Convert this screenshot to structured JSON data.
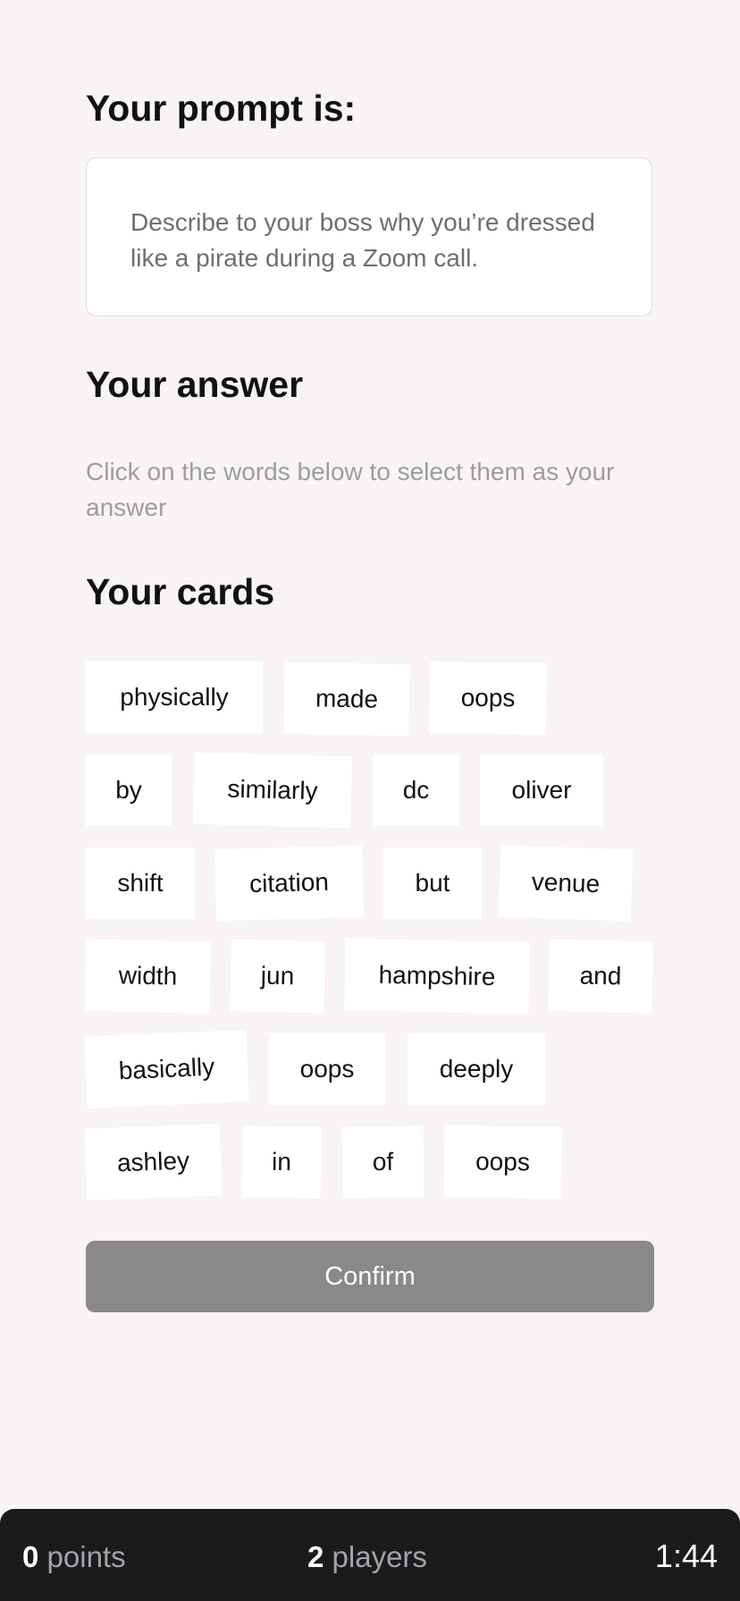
{
  "prompt": {
    "heading": "Your prompt is:",
    "text": "Describe to your boss why you’re dressed like a pirate during a Zoom call."
  },
  "answer": {
    "heading": "Your answer",
    "hint": "Click on the words below to select them as your answer"
  },
  "cards": {
    "heading": "Your cards",
    "items": [
      "physically",
      "made",
      "oops",
      "by",
      "similarly",
      "dc",
      "oliver",
      "shift",
      "citation",
      "but",
      "venue",
      "width",
      "jun",
      "hampshire",
      "and",
      "basically",
      "oops",
      "deeply",
      "ashley",
      "in",
      "of",
      "oops"
    ]
  },
  "confirm_label": "Confirm",
  "footer": {
    "points_value": "0",
    "points_label": "points",
    "players_value": "2",
    "players_label": "players",
    "timer": "1:44"
  },
  "colors": {
    "background": "#f9f4f4",
    "confirm_button": "#8a888b",
    "footer_bar": "#1b1b1d"
  }
}
